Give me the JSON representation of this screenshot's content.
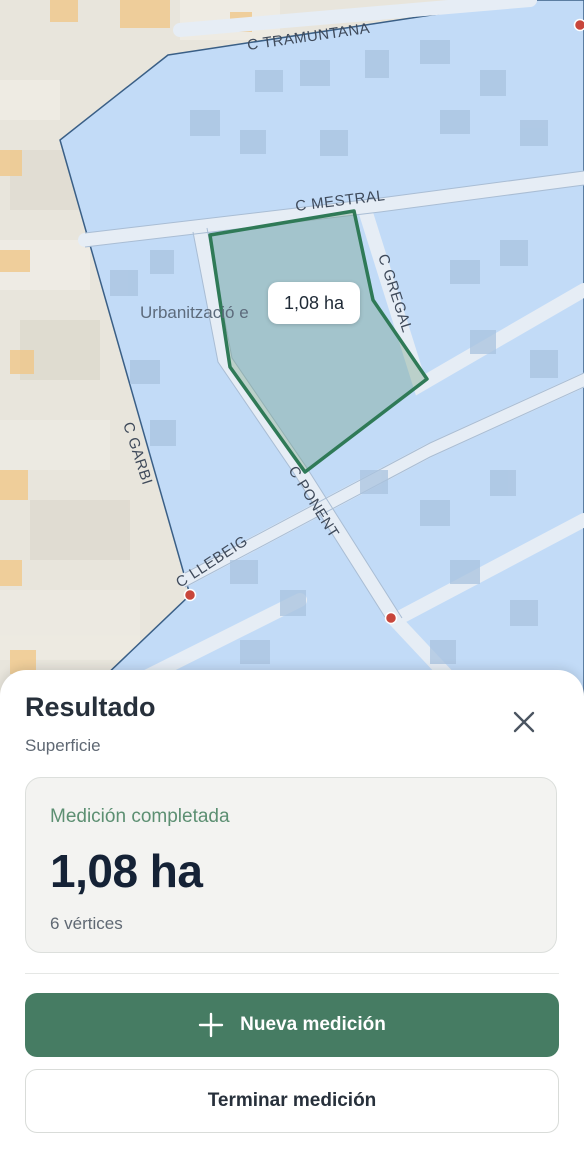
{
  "map": {
    "streets": {
      "tramuntana": "C TRAMUNTANA",
      "mestral": "C MESTRAL",
      "gregal": "C GREGAL",
      "garbi": "C GARBI",
      "ponent": "C PONENT",
      "llebeig": "C LLEBEIG"
    },
    "place_label": "Urbanització e",
    "area_tag": "1,08 ha",
    "colors": {
      "region_fill": "#c2dbf7",
      "region_stroke": "#3a5f86",
      "polygon_stroke": "#2f7a57",
      "marker": "#c8463b"
    }
  },
  "sheet": {
    "title": "Resultado",
    "subtitle": "Superficie",
    "close_icon": "close-icon",
    "card": {
      "status": "Medición completada",
      "value": "1,08 ha",
      "vertices": "6 vértices"
    },
    "primary_button": {
      "icon": "plus-icon",
      "label": "Nueva medición"
    },
    "secondary_button": {
      "label": "Terminar medición"
    }
  }
}
